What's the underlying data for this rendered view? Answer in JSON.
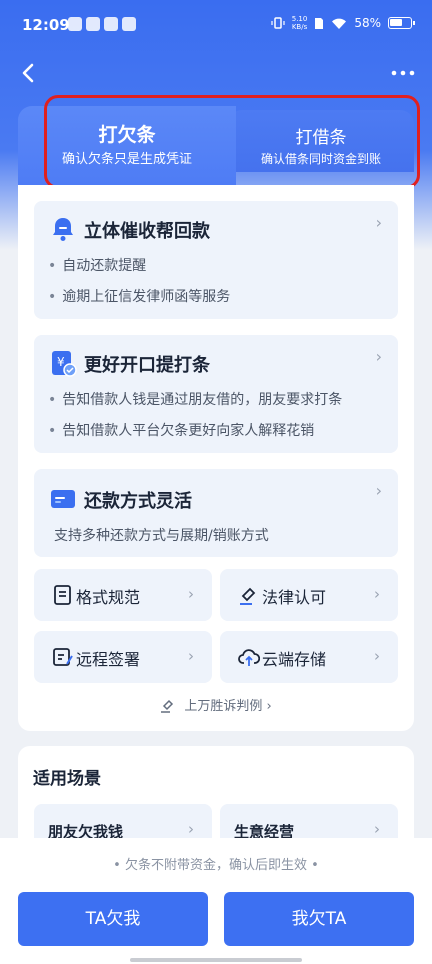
{
  "status_bar": {
    "time": "12:09",
    "net_speed_value": "5.10",
    "net_speed_unit": "KB/s",
    "battery": "58%"
  },
  "tabs": {
    "active": {
      "title": "打欠条",
      "subtitle": "确认欠条只是生成凭证"
    },
    "inactive": {
      "title": "打借条",
      "subtitle": "确认借条同时资金到账"
    }
  },
  "features": [
    {
      "title": "立体催收帮回款",
      "lines": [
        "自动还款提醒",
        "逾期上征信发律师函等服务"
      ]
    },
    {
      "title": "更好开口提打条",
      "lines": [
        "告知借款人钱是通过朋友借的，朋友要求打条",
        "告知借款人平台欠条更好向家人解释花销"
      ]
    },
    {
      "title": "还款方式灵活",
      "desc": "支持多种还款方式与展期/销账方式"
    }
  ],
  "grid": [
    {
      "label": "格式规范",
      "icon": "document-icon"
    },
    {
      "label": "法律认可",
      "icon": "gavel-icon"
    },
    {
      "label": "远程签署",
      "icon": "sign-icon"
    },
    {
      "label": "云端存储",
      "icon": "cloud-upload-icon"
    }
  ],
  "case_link": "上万胜诉判例",
  "scenarios": {
    "title": "适用场景",
    "items": [
      "朋友欠我钱",
      "生意经营"
    ]
  },
  "notice": "欠条不附带资金，确认后即生效",
  "buttons": {
    "left": "TA欠我",
    "right": "我欠TA"
  },
  "colors": {
    "primary": "#3d70f2",
    "highlight": "#e0201f",
    "card_bg": "#eef3fb"
  }
}
